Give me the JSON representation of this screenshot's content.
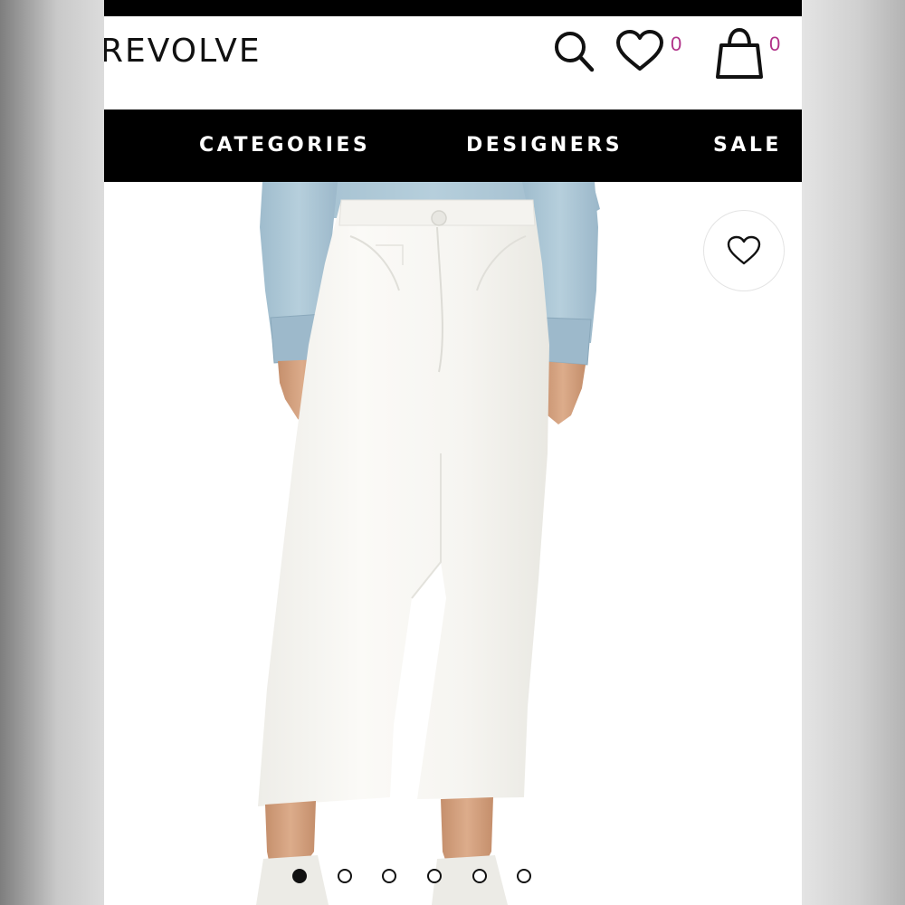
{
  "header": {
    "logo": "REVOLVE",
    "wishlist_count": "0",
    "bag_count": "0"
  },
  "nav": {
    "items": [
      "CATEGORIES",
      "DESIGNERS",
      "SALE"
    ]
  },
  "carousel": {
    "total": 6,
    "active_index": 0
  },
  "icons": {
    "search": "search-icon",
    "wishlist": "heart-icon",
    "bag": "shopping-bag-icon",
    "favorite": "heart-icon"
  },
  "colors": {
    "accent": "#b13189",
    "nav_bg": "#000000",
    "denim": "#a9c4d4",
    "jeans": "#f8f7f3",
    "skin": "#d6a584"
  }
}
